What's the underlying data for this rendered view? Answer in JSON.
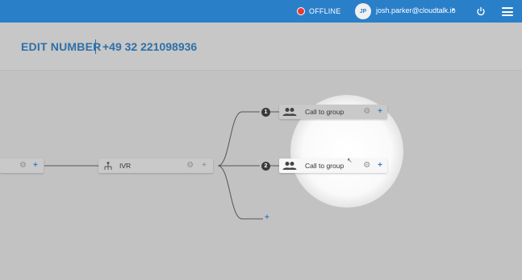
{
  "topbar": {
    "status": "OFFLINE",
    "avatar_initials": "JP",
    "user_email": "josh.parker@cloudtalk.io",
    "caret": "▾"
  },
  "header": {
    "title": "EDIT NUMBER",
    "number": "+49 32 221098936"
  },
  "flow": {
    "start": {
      "gear": "⚙",
      "plus": "+"
    },
    "ivr": {
      "label": "IVR",
      "gear": "⚙",
      "plus": "+"
    },
    "branches": [
      {
        "index": "1",
        "label": "Call to group",
        "gear": "⚙",
        "plus": "+"
      },
      {
        "index": "2",
        "label": "Call to group",
        "gear": "⚙",
        "plus": "+"
      }
    ],
    "add_branch": "+"
  },
  "colors": {
    "topbar": "#2a7fc9",
    "title": "#2e6fa8",
    "offline": "#e53935"
  }
}
